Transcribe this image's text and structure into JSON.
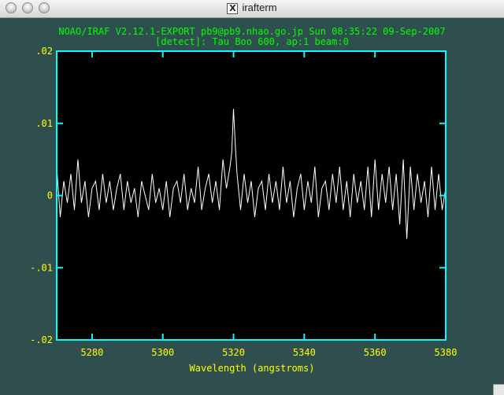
{
  "window": {
    "title": "irafterm",
    "x_logo": "X"
  },
  "plot": {
    "header_line1": "NOAO/IRAF V2.12.1-EXPORT pb9@pb9.nhao.go.jp Sun 08:35:22 09-Sep-2007",
    "header_line2": "[detect]: Tau Boo 600, ap:1 beam:0"
  },
  "colors": {
    "background": "#2f4f4f",
    "frame": "#00ffff",
    "labels": "#ffff00",
    "header": "#00ff00",
    "trace": "#ffffff",
    "plot_area": "#000000"
  },
  "chart_data": {
    "type": "line",
    "title": "",
    "xlabel": "Wavelength (angstroms)",
    "ylabel": "",
    "xlim": [
      5270,
      5380
    ],
    "ylim": [
      -0.02,
      0.02
    ],
    "x_ticks": [
      5280,
      5300,
      5320,
      5340,
      5360,
      5380
    ],
    "y_ticks": [
      0.02,
      0.01,
      0,
      -0.01,
      -0.02
    ],
    "x_tick_labels": [
      "5280",
      "5300",
      "5320",
      "5340",
      "5360",
      "5380"
    ],
    "y_tick_labels": [
      ".02",
      ".01",
      "0",
      "-.01",
      "-.02"
    ],
    "grid": false,
    "series": [
      {
        "x": [
          5270,
          5271,
          5272,
          5273,
          5274,
          5275,
          5276,
          5277,
          5278,
          5279,
          5280,
          5281,
          5282,
          5283,
          5284,
          5285,
          5286,
          5287,
          5288,
          5289,
          5290,
          5291,
          5292,
          5293,
          5294,
          5295,
          5296,
          5297,
          5298,
          5299,
          5300,
          5301,
          5302,
          5303,
          5304,
          5305,
          5306,
          5307,
          5308,
          5309,
          5310,
          5311,
          5312,
          5313,
          5314,
          5315,
          5316,
          5317,
          5318,
          5319,
          5319.5,
          5320,
          5320.5,
          5321,
          5322,
          5323,
          5324,
          5325,
          5326,
          5327,
          5328,
          5329,
          5330,
          5331,
          5332,
          5333,
          5334,
          5335,
          5336,
          5337,
          5338,
          5339,
          5340,
          5341,
          5342,
          5343,
          5344,
          5345,
          5346,
          5347,
          5348,
          5349,
          5350,
          5351,
          5352,
          5353,
          5354,
          5355,
          5356,
          5357,
          5358,
          5359,
          5360,
          5361,
          5362,
          5363,
          5364,
          5365,
          5366,
          5367,
          5368,
          5369,
          5370,
          5371,
          5372,
          5373,
          5374,
          5375,
          5376,
          5377,
          5378,
          5379,
          5380
        ],
        "y": [
          0.004,
          -0.003,
          0.002,
          -0.001,
          0.003,
          -0.002,
          0.005,
          -0.001,
          0.002,
          -0.003,
          0.001,
          0.002,
          -0.002,
          0.003,
          -0.001,
          0.002,
          -0.002,
          0.001,
          0.003,
          -0.002,
          0.002,
          -0.001,
          0.001,
          -0.003,
          0.002,
          0.0,
          -0.002,
          0.003,
          -0.001,
          0.001,
          -0.002,
          0.002,
          -0.003,
          0.001,
          0.002,
          -0.001,
          0.003,
          -0.002,
          0.001,
          -0.001,
          0.004,
          -0.002,
          0.001,
          0.003,
          -0.001,
          0.002,
          -0.002,
          0.005,
          0.001,
          0.004,
          0.006,
          0.012,
          0.007,
          0.003,
          -0.002,
          0.003,
          -0.001,
          0.002,
          -0.003,
          0.001,
          0.002,
          -0.002,
          0.003,
          -0.001,
          0.002,
          -0.002,
          0.004,
          -0.001,
          0.002,
          -0.003,
          0.001,
          0.003,
          -0.002,
          0.002,
          -0.001,
          0.004,
          -0.003,
          0.001,
          0.002,
          -0.002,
          0.003,
          -0.001,
          0.004,
          -0.002,
          0.002,
          -0.003,
          0.003,
          -0.001,
          0.002,
          -0.002,
          0.004,
          -0.003,
          0.005,
          -0.002,
          0.003,
          -0.001,
          0.004,
          -0.002,
          0.003,
          -0.004,
          0.005,
          -0.006,
          0.004,
          -0.002,
          0.003,
          -0.001,
          0.002,
          -0.003,
          0.004,
          -0.002,
          0.003,
          -0.002,
          0.001
        ]
      }
    ]
  }
}
